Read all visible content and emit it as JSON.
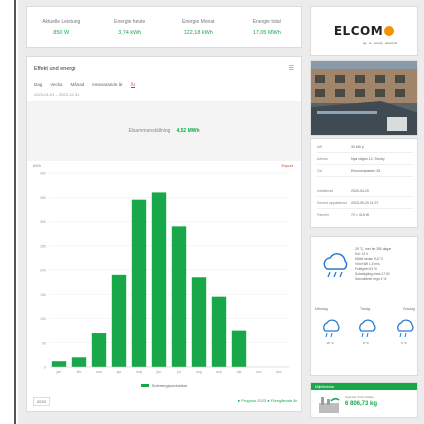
{
  "stats": [
    {
      "label": "Aktuelle Leistung",
      "value": "850 W"
    },
    {
      "label": "Energie heute",
      "value": "3,74 kWh"
    },
    {
      "label": "Energie Monat",
      "value": "122,18 kWh"
    },
    {
      "label": "Energie total",
      "value": "17,05 MWh"
    }
  ],
  "chart_card": {
    "title": "Effekt und energi",
    "tabs": [
      "Dag",
      "Vecka",
      "Månad",
      "Innevarande år",
      "År"
    ],
    "range": "2023-01-01 – 2023-12-31",
    "prod_label": "Elsammanställning",
    "prod_value": "4,52 MWh",
    "unit": "kWh",
    "export_link": "Export"
  },
  "chart_data": {
    "type": "bar",
    "categories": [
      "jan",
      "feb",
      "mar",
      "apr",
      "maj",
      "jun",
      "jul",
      "aug",
      "sep",
      "okt",
      "nov",
      "dec"
    ],
    "values": [
      12,
      20,
      70,
      190,
      345,
      360,
      290,
      185,
      145,
      75,
      0,
      0
    ],
    "ylim": [
      0,
      400
    ],
    "yticks": [
      "0",
      "50",
      "100",
      "150",
      "200",
      "250",
      "300",
      "350",
      "400"
    ],
    "series": [
      {
        "name": "Solenergiproduktion",
        "color": "#18a84a"
      }
    ],
    "grid": true,
    "legend": "bottom"
  },
  "footer": {
    "button": "2023",
    "link": "● Prognos 2023 ● Föregående år"
  },
  "logo": {
    "text": "ELCOM",
    "sub": "ag · el · energi · elkontroll"
  },
  "info": [
    {
      "k": "kW",
      "v": "30 kW p"
    },
    {
      "k": "Adress",
      "v": "Nya vägen 12, Storby"
    },
    {
      "k": "Ort",
      "v": "Ekonomiparken 25"
    },
    {
      "k": "Installerad",
      "v": "2020-04-20"
    },
    {
      "k": "Senast uppdaterad",
      "v": "2023-09-20 11:37"
    },
    {
      "k": "Paneler",
      "v": "72 × 415 W"
    }
  ],
  "weather": {
    "lines": [
      "25 °C, mer än 280 dagar",
      "Sol: 12 h",
      "Mörkt sedan 9,8 °C",
      "",
      "Vind NW 1,5 m/s",
      "Fuktighet 61 %",
      "Solnedgång cirka 17:00",
      "Sannolikhet regn 4 %"
    ],
    "days": [
      "Måndag",
      "Tisdag",
      "Onsdag"
    ],
    "day_temps": [
      "15 °C",
      "8 °C",
      "5 °C"
    ]
  },
  "savings": {
    "header": "Miljöfördelar",
    "label": "Sparade CO2-utsläpp",
    "value": "6 806,73 kg"
  },
  "colors": {
    "accent": "#18a84a",
    "tab_active": "#e5322d",
    "logo_orange": "#f29400"
  }
}
